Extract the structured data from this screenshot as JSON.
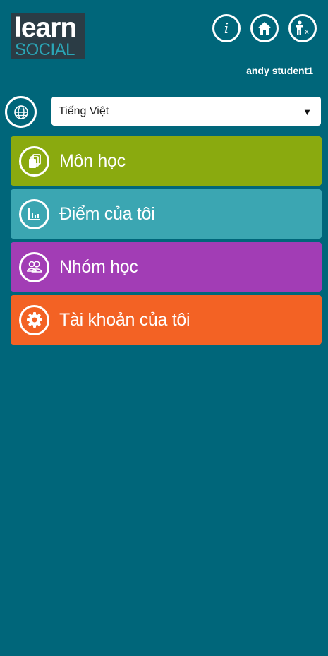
{
  "header": {
    "logo": {
      "line1": "learn",
      "line2": "SOCIAL"
    },
    "icons": [
      "info-icon",
      "home-icon",
      "exit-accessibility-icon"
    ],
    "username": "andy student1"
  },
  "language": {
    "icon": "globe-icon",
    "selected": "Tiếng Việt"
  },
  "menu": [
    {
      "label": "Môn học",
      "icon": "courses-icon",
      "color": "#8aaa0f"
    },
    {
      "label": "Điểm của tôi",
      "icon": "grades-chart-icon",
      "color": "#3ba6b2"
    },
    {
      "label": "Nhóm học",
      "icon": "group-icon",
      "color": "#a23db5"
    },
    {
      "label": "Tài khoản của tôi",
      "icon": "settings-gear-icon",
      "color": "#f36224"
    }
  ],
  "colors": {
    "background": "#00667a",
    "logo_accent": "#2aa6b7"
  }
}
